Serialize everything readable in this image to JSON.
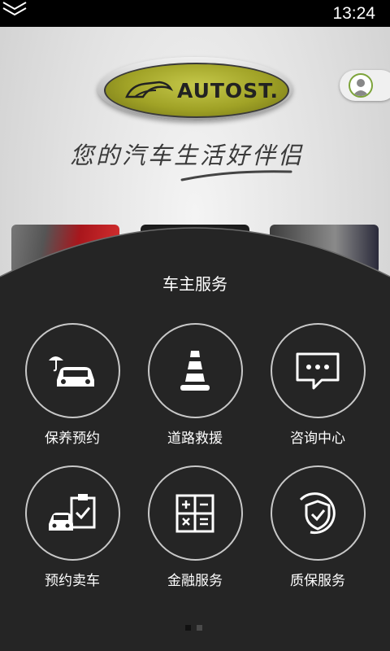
{
  "status_bar": {
    "time": "13:24"
  },
  "header": {
    "logo_text": "AUTOST.",
    "slogan": "您的汽车生活好伴侣"
  },
  "panel": {
    "title": "车主服务",
    "services": [
      {
        "label": "保养预约",
        "icon": "car-umbrella-icon"
      },
      {
        "label": "道路救援",
        "icon": "traffic-cone-icon"
      },
      {
        "label": "咨询中心",
        "icon": "chat-bubble-icon"
      },
      {
        "label": "预约卖车",
        "icon": "car-clipboard-icon"
      },
      {
        "label": "金融服务",
        "icon": "calculator-icon"
      },
      {
        "label": "质保服务",
        "icon": "shield-check-icon"
      }
    ],
    "pager": {
      "current": 1,
      "total": 2
    }
  },
  "colors": {
    "panel_bg": "#252525",
    "logo_yellow": "#a0a226",
    "status_bar": "#000000"
  }
}
